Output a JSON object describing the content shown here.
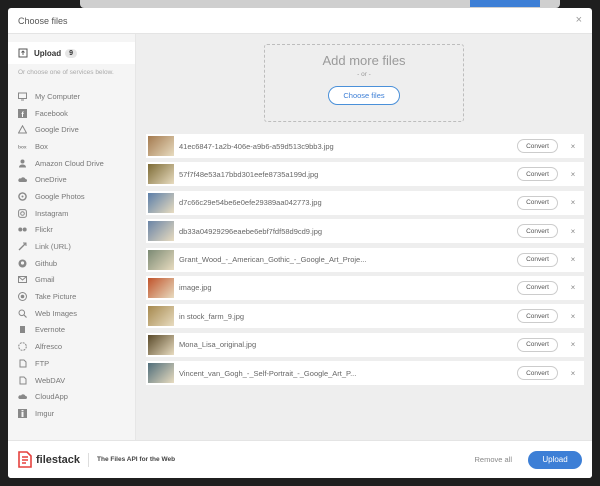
{
  "header": {
    "title": "Choose files",
    "close_icon": "×"
  },
  "sidebar": {
    "upload_label": "Upload",
    "upload_count": "9",
    "or_choose": "Or choose one of services below.",
    "services": [
      {
        "label": "My Computer",
        "icon": "monitor-icon"
      },
      {
        "label": "Facebook",
        "icon": "facebook-icon"
      },
      {
        "label": "Google Drive",
        "icon": "google-drive-icon"
      },
      {
        "label": "Box",
        "icon": "box-icon"
      },
      {
        "label": "Amazon Cloud Drive",
        "icon": "amazon-cloud-icon"
      },
      {
        "label": "OneDrive",
        "icon": "onedrive-icon"
      },
      {
        "label": "Google Photos",
        "icon": "google-photos-icon"
      },
      {
        "label": "Instagram",
        "icon": "instagram-icon"
      },
      {
        "label": "Flickr",
        "icon": "flickr-icon"
      },
      {
        "label": "Link (URL)",
        "icon": "link-icon"
      },
      {
        "label": "Github",
        "icon": "github-icon"
      },
      {
        "label": "Gmail",
        "icon": "gmail-icon"
      },
      {
        "label": "Take Picture",
        "icon": "camera-icon"
      },
      {
        "label": "Web Images",
        "icon": "web-search-icon"
      },
      {
        "label": "Evernote",
        "icon": "evernote-icon"
      },
      {
        "label": "Alfresco",
        "icon": "alfresco-icon"
      },
      {
        "label": "FTP",
        "icon": "ftp-icon"
      },
      {
        "label": "WebDAV",
        "icon": "webdav-icon"
      },
      {
        "label": "CloudApp",
        "icon": "cloudapp-icon"
      },
      {
        "label": "Imgur",
        "icon": "imgur-icon"
      }
    ]
  },
  "dropzone": {
    "title": "Add more files",
    "or": "- or -",
    "choose_label": "Choose files"
  },
  "files": [
    {
      "name": "41ec6847-1a2b-406e-a9b6-a59d513c9bb3.jpg",
      "thumb_color": "#a47a4f"
    },
    {
      "name": "57f7f48e53a17bbd301eefe8735a199d.jpg",
      "thumb_color": "#7d6b36"
    },
    {
      "name": "d7c66c29e54be6e0efe29389aa042773.jpg",
      "thumb_color": "#5b7ea8"
    },
    {
      "name": "db33a04929296eaebe6ebf7fdf58d9cd9.jpg",
      "thumb_color": "#6a84a6"
    },
    {
      "name": "Grant_Wood_-_American_Gothic_-_Google_Art_Proje...",
      "thumb_color": "#7b8a74"
    },
    {
      "name": "image.jpg",
      "thumb_color": "#c0532b"
    },
    {
      "name": "in stock_farm_9.jpg",
      "thumb_color": "#a6894e"
    },
    {
      "name": "Mona_Lisa_original.jpg",
      "thumb_color": "#5a4a2a"
    },
    {
      "name": "Vincent_van_Gogh_-_Self-Portrait_-_Google_Art_P...",
      "thumb_color": "#4f6d7a"
    }
  ],
  "file_actions": {
    "convert_label": "Convert",
    "remove_icon": "×"
  },
  "footer": {
    "brand": "filestack",
    "tagline": "The Files API for the Web",
    "remove_all": "Remove all",
    "upload_label": "Upload"
  },
  "colors": {
    "accent": "#3d7fd6",
    "brand_red": "#e5413d"
  }
}
